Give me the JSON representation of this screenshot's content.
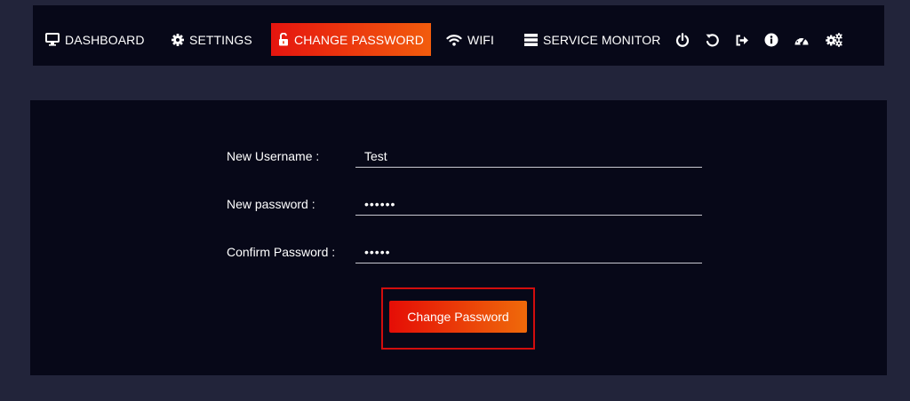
{
  "nav": {
    "items": [
      {
        "label": "DASHBOARD",
        "icon": "monitor-icon"
      },
      {
        "label": "SETTINGS",
        "icon": "gear-icon"
      },
      {
        "label": "CHANGE PASSWORD",
        "icon": "unlock-icon",
        "active": true
      },
      {
        "label": "WIFI",
        "icon": "wifi-icon"
      },
      {
        "label": "SERVICE MONITOR",
        "icon": "server-icon"
      }
    ],
    "utility_icons": [
      "power-icon",
      "undo-icon",
      "logout-icon",
      "info-icon",
      "speedometer-icon",
      "gears-icon"
    ]
  },
  "form": {
    "username_label": "New Username :",
    "username_value": "Test",
    "password_label": "New password :",
    "password_value": "••••••",
    "confirm_label": "Confirm Password :",
    "confirm_value": "•••••",
    "submit_label": "Change Password"
  },
  "colors": {
    "page_background": "#22243a",
    "panel_background": "#070818",
    "accent_start": "#e5150f",
    "accent_end": "#f25c0d",
    "highlight_border": "#d20d0d"
  }
}
